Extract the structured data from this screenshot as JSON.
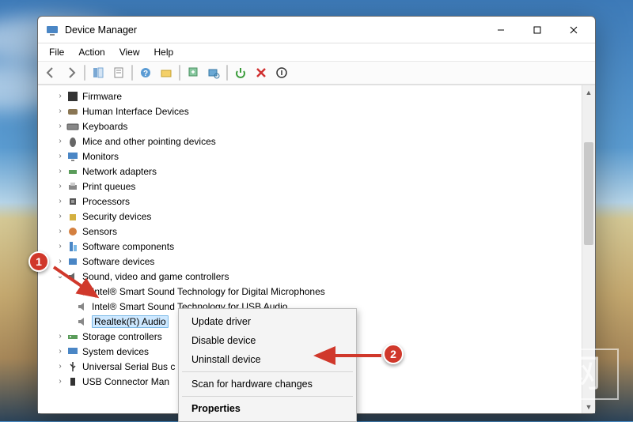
{
  "window": {
    "title": "Device Manager"
  },
  "menubar": [
    "File",
    "Action",
    "View",
    "Help"
  ],
  "tree": {
    "items": [
      {
        "label": "Firmware",
        "icon": "chip"
      },
      {
        "label": "Human Interface Devices",
        "icon": "hid"
      },
      {
        "label": "Keyboards",
        "icon": "keyboard"
      },
      {
        "label": "Mice and other pointing devices",
        "icon": "mouse"
      },
      {
        "label": "Monitors",
        "icon": "monitor"
      },
      {
        "label": "Network adapters",
        "icon": "net"
      },
      {
        "label": "Print queues",
        "icon": "printer"
      },
      {
        "label": "Processors",
        "icon": "cpu"
      },
      {
        "label": "Security devices",
        "icon": "security"
      },
      {
        "label": "Sensors",
        "icon": "sensor"
      },
      {
        "label": "Software components",
        "icon": "swcomp"
      },
      {
        "label": "Software devices",
        "icon": "swdev"
      }
    ],
    "expanded": {
      "label": "Sound, video and game controllers",
      "children": [
        {
          "label": "Intel® Smart Sound Technology for Digital Microphones"
        },
        {
          "label": "Intel® Smart Sound Technology for USB Audio"
        },
        {
          "label": "Realtek(R) Audio",
          "selected": true
        }
      ]
    },
    "after": [
      {
        "label": "Storage controllers",
        "icon": "storage"
      },
      {
        "label": "System devices",
        "icon": "system"
      },
      {
        "label": "Universal Serial Bus c",
        "icon": "usb"
      },
      {
        "label": "USB Connector Man",
        "icon": "usbconn"
      }
    ]
  },
  "context_menu": {
    "items": [
      {
        "label": "Update driver"
      },
      {
        "label": "Disable device"
      },
      {
        "label": "Uninstall device"
      },
      {
        "sep": true
      },
      {
        "label": "Scan for hardware changes"
      },
      {
        "sep": true
      },
      {
        "label": "Properties",
        "bold": true
      }
    ]
  },
  "callouts": {
    "one": "1",
    "two": "2"
  }
}
